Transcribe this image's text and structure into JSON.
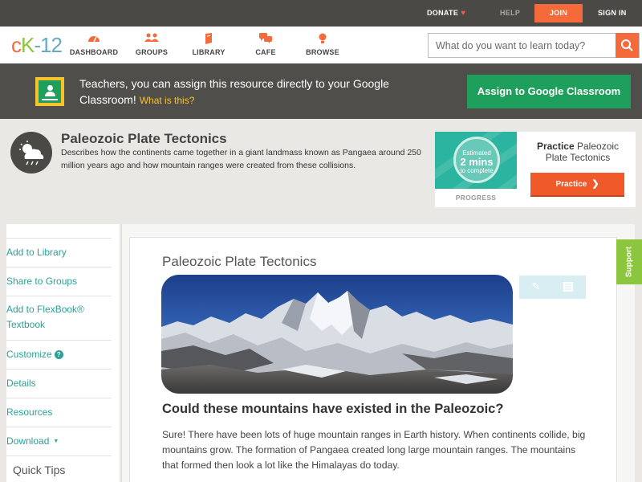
{
  "topbar": {
    "donate": "DONATE",
    "help": "HELP",
    "join": "JOIN",
    "signin": "SIGN IN"
  },
  "logo": {
    "c": "c",
    "k": "K",
    "rest": "-12"
  },
  "nav": [
    {
      "label": "DASHBOARD",
      "icon": "dashboard-icon"
    },
    {
      "label": "GROUPS",
      "icon": "groups-icon"
    },
    {
      "label": "LIBRARY",
      "icon": "library-icon"
    },
    {
      "label": "CAFE",
      "icon": "cafe-icon"
    },
    {
      "label": "BROWSE",
      "icon": "browse-icon"
    }
  ],
  "search": {
    "placeholder": "What do you want to learn today?"
  },
  "google_banner": {
    "text": "Teachers, you can assign this resource directly to your Google Classroom!",
    "link": "What is this?",
    "button": "Assign to Google Classroom"
  },
  "resource": {
    "title": "Paleozoic Plate Tectonics",
    "description": "Describes how the continents came together in a giant landmass known as Pangaea around 250 million years ago and how mountain ranges were created from these collisions."
  },
  "practice": {
    "estimated": "Estimated",
    "minutes": "2 mins",
    "to_complete": "to complete",
    "progress_label": "PROGRESS",
    "title_bold": "Practice",
    "title_rest": "Paleozoic Plate Tectonics",
    "button": "Practice"
  },
  "sidebar": {
    "items": [
      {
        "label": "Add to Library"
      },
      {
        "label": "Share to Groups"
      },
      {
        "label": "Add to FlexBook® Textbook"
      },
      {
        "label": "Customize"
      },
      {
        "label": "Details"
      },
      {
        "label": "Resources"
      },
      {
        "label": "Download"
      }
    ],
    "quick_tips": "Quick Tips"
  },
  "content": {
    "title": "Paleozoic Plate Tectonics",
    "heading": "Could these mountains have existed in the Paleozoic?",
    "body": "Sure! There have been lots of huge mountain ranges in Earth history. When continents collide, big mountains grow. The formation of Pangaea created long large mountain ranges. The mountains that formed then look a lot like the Himalayas do today."
  },
  "support": "Support",
  "colors": {
    "brand_orange": "#f46a3a",
    "brand_green": "#8cc63f",
    "classroom_green": "#1e9f5b",
    "link_teal": "#2aa198"
  }
}
